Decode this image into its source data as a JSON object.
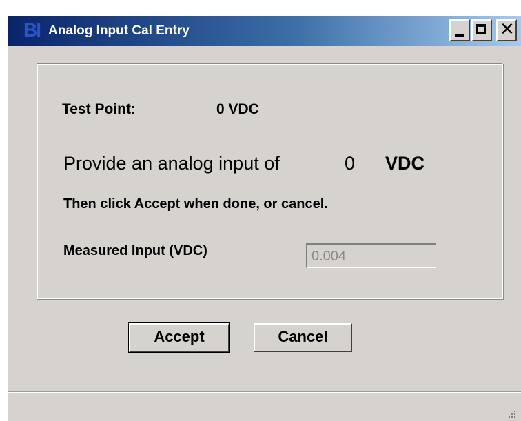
{
  "window": {
    "title": "Analog Input Cal Entry",
    "icon_text": "BI",
    "icon": "app-logo-icon"
  },
  "caption_buttons": {
    "minimize_icon": "minimize-icon",
    "maximize_icon": "maximize-icon",
    "close_icon": "close-icon",
    "close_glyph": "✕"
  },
  "content": {
    "test_point_label": "Test Point:",
    "test_point_value": "0 VDC",
    "provide_label": "Provide an analog input of",
    "provide_value": "0",
    "provide_unit": "VDC",
    "instruction": "Then click Accept when done, or cancel.",
    "measured_label": "Measured Input (VDC)",
    "measured_value": "0.004"
  },
  "buttons": {
    "accept_label": "Accept",
    "cancel_label": "Cancel"
  },
  "colors": {
    "dialog_face": "#d6d3ce",
    "titlebar_start": "#0a246a",
    "titlebar_end": "#a6caf0",
    "disabled_text": "#8a8a8a"
  }
}
